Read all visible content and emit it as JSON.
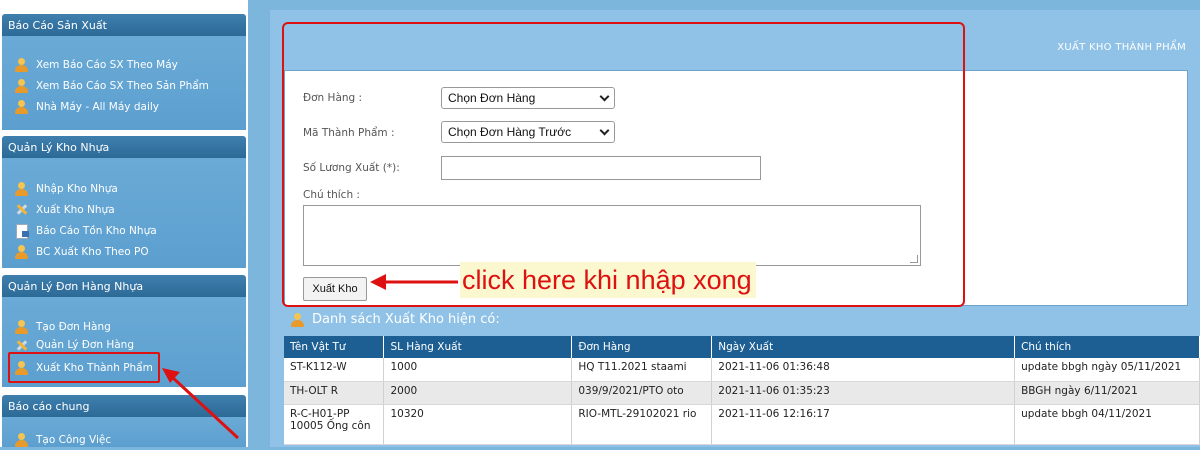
{
  "sidebar": {
    "sections": [
      {
        "title": "Báo Cáo Sản Xuất",
        "items": [
          {
            "label": "Xem Báo Cáo SX Theo Máy",
            "icon": "user-icon"
          },
          {
            "label": "Xem Báo Cáo SX Theo Sản Phẩm",
            "icon": "user-icon"
          },
          {
            "label": "Nhà Máy - All Máy daily",
            "icon": "user-icon"
          }
        ]
      },
      {
        "title": "Quản Lý Kho Nhựa",
        "items": [
          {
            "label": "Nhập Kho Nhựa",
            "icon": "user-icon"
          },
          {
            "label": "Xuất Kho Nhựa",
            "icon": "tools-icon"
          },
          {
            "label": "Báo Cáo Tồn Kho Nhựa",
            "icon": "document-icon"
          },
          {
            "label": "BC Xuất Kho Theo PO",
            "icon": "user-icon"
          }
        ]
      },
      {
        "title": "Quản Lý Đơn Hàng Nhựa",
        "items": [
          {
            "label": "Tạo Đơn Hàng",
            "icon": "user-icon"
          },
          {
            "label": "Quản Lý Đơn Hàng",
            "icon": "tools-icon"
          },
          {
            "label": "Xuất Kho Thành Phẩm",
            "icon": "user-icon",
            "selected": true
          }
        ]
      },
      {
        "title": "Báo cáo chung",
        "items": [
          {
            "label": "Tạo Công Việc",
            "icon": "user-icon"
          }
        ]
      }
    ]
  },
  "main": {
    "page_title": "XUẤT KHO THÀNH PHẨM",
    "form": {
      "order_label": "Đơn Hàng :",
      "order_value": "Chọn Đơn Hàng",
      "product_label": "Mã Thành Phẩm :",
      "product_value": "Chọn Đơn Hàng Trước",
      "qty_label": "Số Lương Xuất (*):",
      "qty_value": "",
      "note_label": "Chú thích :",
      "note_value": "",
      "submit_label": "Xuất Kho"
    },
    "callout_text": "click here khi nhập xong",
    "list_title": "Danh sách Xuất Kho hiện có:",
    "table": {
      "headers": [
        "Tên Vật Tư",
        "SL Hàng Xuất",
        "Đơn Hàng",
        "Ngày Xuất",
        "Chú thích"
      ],
      "rows": [
        [
          "ST-K112-W",
          "1000",
          "HQ T11.2021 staami",
          "2021-11-06 01:36:48",
          "update bbgh ngày 05/11/2021"
        ],
        [
          "TH-OLT R",
          "2000",
          "039/9/2021/PTO oto",
          "2021-11-06 01:35:23",
          "BBGH ngày 6/11/2021"
        ],
        [
          "R-C-H01-PP 10005 Ống côn",
          "10320",
          "RIO-MTL-29102021 rio",
          "2021-11-06 12:16:17",
          "update bbgh 04/11/2021"
        ]
      ]
    }
  },
  "colors": {
    "accent_red": "#dd1111",
    "header_blue": "#1d5f93",
    "sidebar_blue": "#5c9fcf",
    "main_bg": "#8fc2e6"
  }
}
